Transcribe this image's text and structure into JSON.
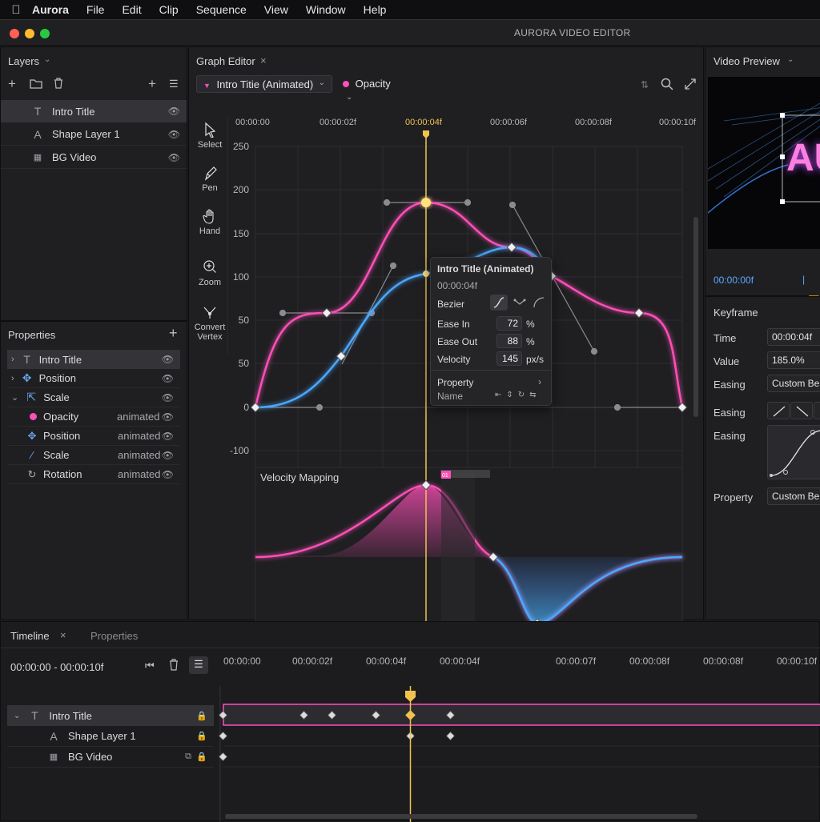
{
  "menubar": {
    "app": "Aurora",
    "items": [
      "File",
      "Edit",
      "Clip",
      "Sequence",
      "View",
      "Window",
      "Help"
    ]
  },
  "window": {
    "title": "AURORA VIDEO EDITOR"
  },
  "layers": {
    "title": "Layers",
    "items": [
      {
        "label": "Intro Title",
        "icon": "text-icon"
      },
      {
        "label": "Shape Layer 1",
        "icon": "shape-text-icon"
      },
      {
        "label": "BG Video",
        "icon": "film-icon"
      }
    ]
  },
  "properties": {
    "title": "Properties",
    "groups": [
      "Intro Title",
      "Position",
      "Scale"
    ],
    "items": [
      {
        "label": "Opacity",
        "status": "animated"
      },
      {
        "label": "Position",
        "status": "animated"
      },
      {
        "label": "Scale",
        "status": "animated"
      },
      {
        "label": "Rotation",
        "status": "animated"
      }
    ]
  },
  "graph_editor": {
    "tab": "Graph Editor",
    "layer_select": "Intro Titie (Animated)",
    "property_select": "Opacity",
    "time_ticks": [
      "00:00:00",
      "00:00:02f",
      "00:00:04f",
      "00:00:06f",
      "00:00:08f",
      "00:00:10f"
    ],
    "y_ticks": [
      "250",
      "200",
      "150",
      "100",
      "50",
      "50",
      "0",
      "-100"
    ],
    "tools": [
      "Select",
      "Pen",
      "Hand",
      "Zoom",
      "Convert Vertex"
    ],
    "velocity_label": "Velocity Mapping",
    "marker_badge": "01"
  },
  "popup": {
    "title": "Intro Title (Animated)",
    "time": "00:00:04f",
    "bezier_label": "Bezier",
    "ease_in_label": "Ease In",
    "ease_in": "72",
    "ease_in_unit": "%",
    "ease_out_label": "Ease Out",
    "ease_out": "88",
    "ease_out_unit": "%",
    "velocity_label": "Velocity",
    "velocity": "145",
    "velocity_unit": "px/s",
    "property_label": "Property",
    "name_label": "Name"
  },
  "preview": {
    "title": "Video Preview",
    "timecode": "00:00:00f",
    "overlay_text": "AU"
  },
  "keyframe": {
    "title": "Keyframe",
    "time_label": "Time",
    "time": "00:00:04f",
    "value_label": "Value",
    "value": "185.0%",
    "easing_label": "Easing",
    "easing_value": "Custom Be",
    "easing2_label": "Easing",
    "easing3_label": "Easing",
    "property_label": "Property",
    "property_value": "Custom Be"
  },
  "timeline": {
    "tab": "Timeline",
    "tab2": "Properties",
    "range": "00:00:00 - 00:00:10f",
    "ticks": [
      "00:00:00",
      "00:00:02f",
      "00:00:04f",
      "00:00:04f",
      "00:00:07f",
      "00:00:08f",
      "00:00:08f",
      "00:00:10f"
    ],
    "tracks": [
      {
        "label": "Intro Title"
      },
      {
        "label": "Shape Layer 1"
      },
      {
        "label": "BG Video"
      }
    ]
  },
  "colors": {
    "pink": "#ff4fb8",
    "blue": "#4aa8ff",
    "playhead": "#f2c14e",
    "accent": "#5aa9ff"
  }
}
